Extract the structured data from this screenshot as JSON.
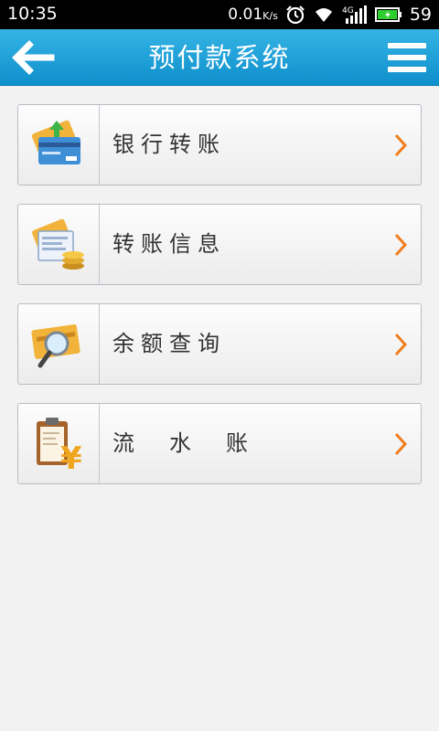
{
  "status_bar": {
    "time": "10:35",
    "net_speed": "0.01",
    "net_speed_unit": "K/s",
    "battery": "59"
  },
  "header": {
    "title": "预付款系统",
    "background": "#1a9fd8"
  },
  "menu_items": [
    {
      "label": "银行转账",
      "icon": "bank-card-transfer-icon"
    },
    {
      "label": "转账信息",
      "icon": "transfer-info-icon"
    },
    {
      "label": "余额查询",
      "icon": "balance-query-icon"
    },
    {
      "label": "流　水　账",
      "icon": "ledger-clipboard-icon"
    }
  ],
  "colors": {
    "chevron": "#f07d1e",
    "item_border": "#b9bcc4",
    "text": "#333333"
  }
}
